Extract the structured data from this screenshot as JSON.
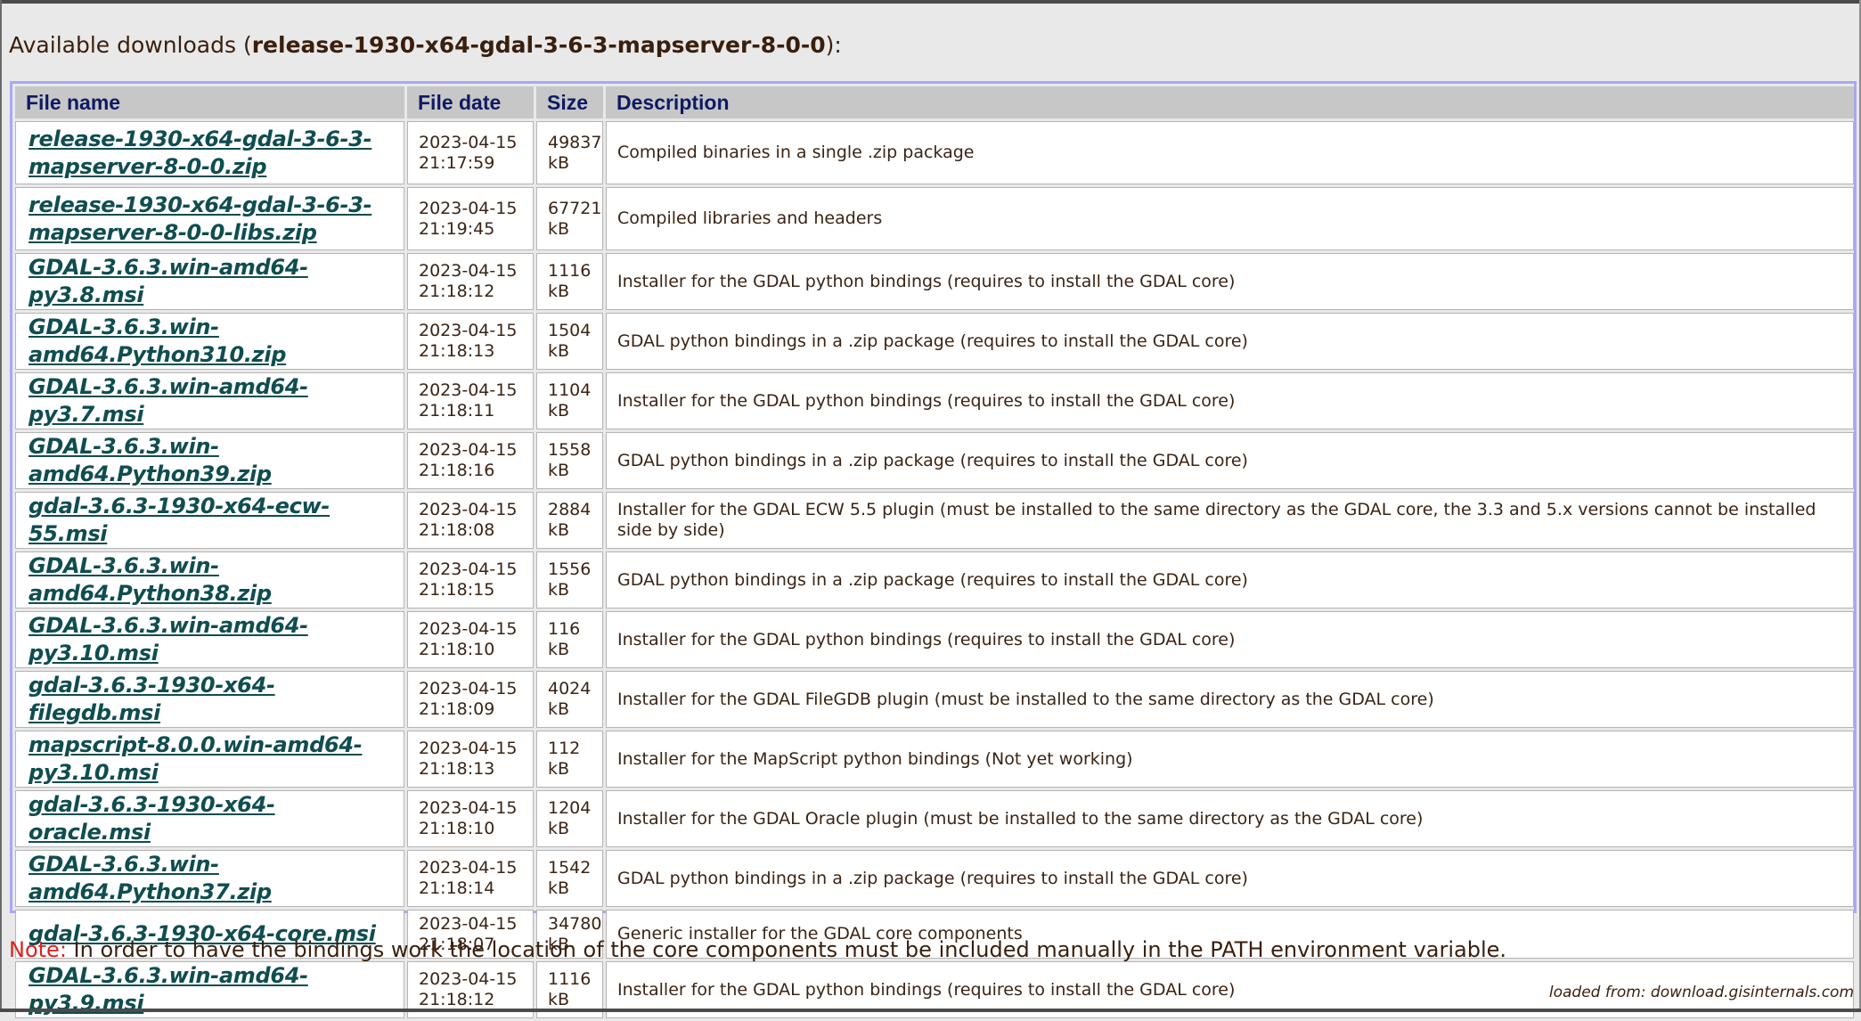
{
  "heading": {
    "prefix": "Available downloads (",
    "release": "release-1930-x64-gdal-3-6-3-mapserver-8-0-0",
    "suffix": "):"
  },
  "table": {
    "headers": {
      "name": "File name",
      "date": "File date",
      "size": "Size",
      "description": "Description"
    },
    "rows": [
      {
        "name": "release-1930-x64-gdal-3-6-3-mapserver-8-0-0.zip",
        "date": "2023-04-15 21:17:59",
        "size": "49837 kB",
        "description": "Compiled binaries in a single .zip package"
      },
      {
        "name": "release-1930-x64-gdal-3-6-3-mapserver-8-0-0-libs.zip",
        "date": "2023-04-15 21:19:45",
        "size": "67721 kB",
        "description": "Compiled libraries and headers"
      },
      {
        "name": "GDAL-3.6.3.win-amd64-py3.8.msi",
        "date": "2023-04-15 21:18:12",
        "size": "1116 kB",
        "description": "Installer for the GDAL python bindings (requires to install the GDAL core)"
      },
      {
        "name": "GDAL-3.6.3.win-amd64.Python310.zip",
        "date": "2023-04-15 21:18:13",
        "size": "1504 kB",
        "description": "GDAL python bindings in a .zip package (requires to install the GDAL core)"
      },
      {
        "name": "GDAL-3.6.3.win-amd64-py3.7.msi",
        "date": "2023-04-15 21:18:11",
        "size": "1104 kB",
        "description": "Installer for the GDAL python bindings (requires to install the GDAL core)"
      },
      {
        "name": "GDAL-3.6.3.win-amd64.Python39.zip",
        "date": "2023-04-15 21:18:16",
        "size": "1558 kB",
        "description": "GDAL python bindings in a .zip package (requires to install the GDAL core)"
      },
      {
        "name": "gdal-3.6.3-1930-x64-ecw-55.msi",
        "date": "2023-04-15 21:18:08",
        "size": "2884 kB",
        "description": "Installer for the GDAL ECW 5.5 plugin (must be installed to the same directory as the GDAL core, the 3.3 and 5.x versions cannot be installed side by side)"
      },
      {
        "name": "GDAL-3.6.3.win-amd64.Python38.zip",
        "date": "2023-04-15 21:18:15",
        "size": "1556 kB",
        "description": "GDAL python bindings in a .zip package (requires to install the GDAL core)"
      },
      {
        "name": "GDAL-3.6.3.win-amd64-py3.10.msi",
        "date": "2023-04-15 21:18:10",
        "size": "116 kB",
        "description": "Installer for the GDAL python bindings (requires to install the GDAL core)"
      },
      {
        "name": "gdal-3.6.3-1930-x64-filegdb.msi",
        "date": "2023-04-15 21:18:09",
        "size": "4024 kB",
        "description": "Installer for the GDAL FileGDB plugin (must be installed to the same directory as the GDAL core)"
      },
      {
        "name": "mapscript-8.0.0.win-amd64-py3.10.msi",
        "date": "2023-04-15 21:18:13",
        "size": "112 kB",
        "description": "Installer for the MapScript python bindings (Not yet working)"
      },
      {
        "name": "gdal-3.6.3-1930-x64-oracle.msi",
        "date": "2023-04-15 21:18:10",
        "size": "1204 kB",
        "description": "Installer for the GDAL Oracle plugin (must be installed to the same directory as the GDAL core)"
      },
      {
        "name": "GDAL-3.6.3.win-amd64.Python37.zip",
        "date": "2023-04-15 21:18:14",
        "size": "1542 kB",
        "description": "GDAL python bindings in a .zip package (requires to install the GDAL core)"
      },
      {
        "name": "gdal-3.6.3-1930-x64-core.msi",
        "date": "2023-04-15 21:18:07",
        "size": "34780 kB",
        "description": "Generic installer for the GDAL core components"
      },
      {
        "name": "GDAL-3.6.3.win-amd64-py3.9.msi",
        "date": "2023-04-15 21:18:12",
        "size": "1116 kB",
        "description": "Installer for the GDAL python bindings (requires to install the GDAL core)"
      }
    ]
  },
  "note": {
    "label": "Note:",
    "text": " In order to have the bindings work the location of the core components must be included manually in the PATH environment variable."
  },
  "footer": {
    "loaded_from": "loaded from: download.gisinternals.com"
  },
  "colors": {
    "link": "#0f4d50",
    "header_text": "#0e1a63",
    "note_label": "#e01e1e",
    "frame": "#a8a8f2"
  }
}
